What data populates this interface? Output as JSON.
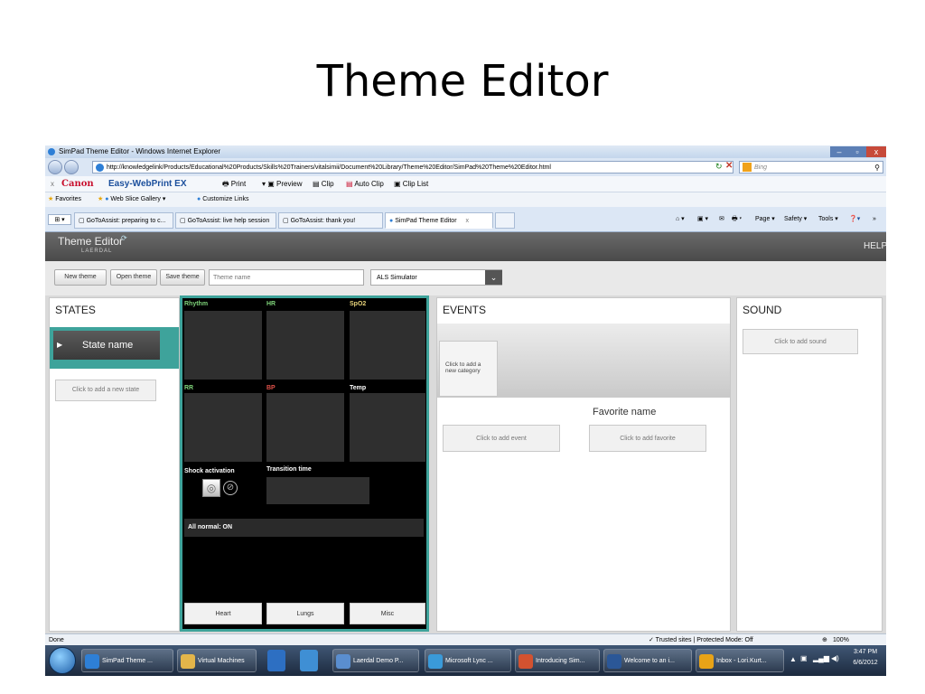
{
  "slide": {
    "title": "Theme Editor"
  },
  "browser": {
    "window_title": "SimPad Theme Editor - Windows Internet Explorer",
    "url": "http://knowledgelink/Products/Educational%20Products/Skills%20Trainers/vitalsimii/Document%20Library/Theme%20Editor/SimPad%20Theme%20Editor.html",
    "search_placeholder": "Bing",
    "window_controls": {
      "min": "–",
      "max": "▫",
      "close": "x"
    },
    "canon_bar": {
      "close": "x",
      "brand": "Canon",
      "product": "Easy-WebPrint EX",
      "print": "Print",
      "preview": "Preview",
      "clip": "Clip",
      "auto_clip": "Auto Clip",
      "clip_list": "Clip List"
    },
    "favorites_bar": {
      "favorites": "Favorites",
      "web_slice": "Web Slice Gallery ▾",
      "customize": "Customize Links"
    },
    "tabs": [
      {
        "label": "GoToAssist: preparing to c..."
      },
      {
        "label": "GoToAssist: live help session"
      },
      {
        "label": "GoToAssist: thank you!"
      },
      {
        "label": "SimPad Theme Editor"
      }
    ],
    "tab_close": "x",
    "command_bar": {
      "page": "Page ▾",
      "safety": "Safety ▾",
      "tools": "Tools ▾"
    },
    "status": {
      "left": "Done",
      "zone": "✓ Trusted sites | Protected Mode: Off",
      "zoom": "100%"
    }
  },
  "app": {
    "title": "Theme Editor",
    "brand": "LAERDAL",
    "help": "HELP",
    "toolbar": {
      "new_theme": "New theme",
      "open_theme": "Open theme",
      "save_theme": "Save theme",
      "theme_name_placeholder": "Theme name",
      "simulator": "ALS Simulator"
    },
    "states": {
      "heading": "STATES",
      "state_name": "State name",
      "add_state": "Click to add a new state"
    },
    "monitor": {
      "rhythm": "Rhythm",
      "hr": "HR",
      "spo2": "SpO2",
      "rr": "RR",
      "bp": "BP",
      "temp": "Temp",
      "shock": "Shock activation",
      "transition": "Transition time",
      "all_normal": "All normal: ON",
      "tabs": [
        "Heart",
        "Lungs",
        "Misc"
      ]
    },
    "events": {
      "heading": "EVENTS",
      "add_category": "Click to add a new category",
      "favorite_name": "Favorite name",
      "add_event": "Click to add event",
      "add_favorite": "Click to add favorite"
    },
    "sound": {
      "heading": "SOUND",
      "add_sound": "Click to add sound"
    }
  },
  "taskbar": {
    "items": [
      {
        "label": "SimPad Theme ..."
      },
      {
        "label": "Virtual Machines"
      },
      {
        "label": "Laerdal Demo P..."
      },
      {
        "label": "Microsoft Lync ..."
      },
      {
        "label": "Introducing Sim..."
      },
      {
        "label": "Welcome to an i..."
      },
      {
        "label": "Inbox - Lori.Kurt..."
      }
    ],
    "time": "3:47 PM",
    "date": "6/6/2012"
  },
  "colors": {
    "accent_teal": "#3ea39b",
    "label_green": "#7fd47a",
    "label_red": "#e0524a",
    "header_gray": "#555555"
  }
}
